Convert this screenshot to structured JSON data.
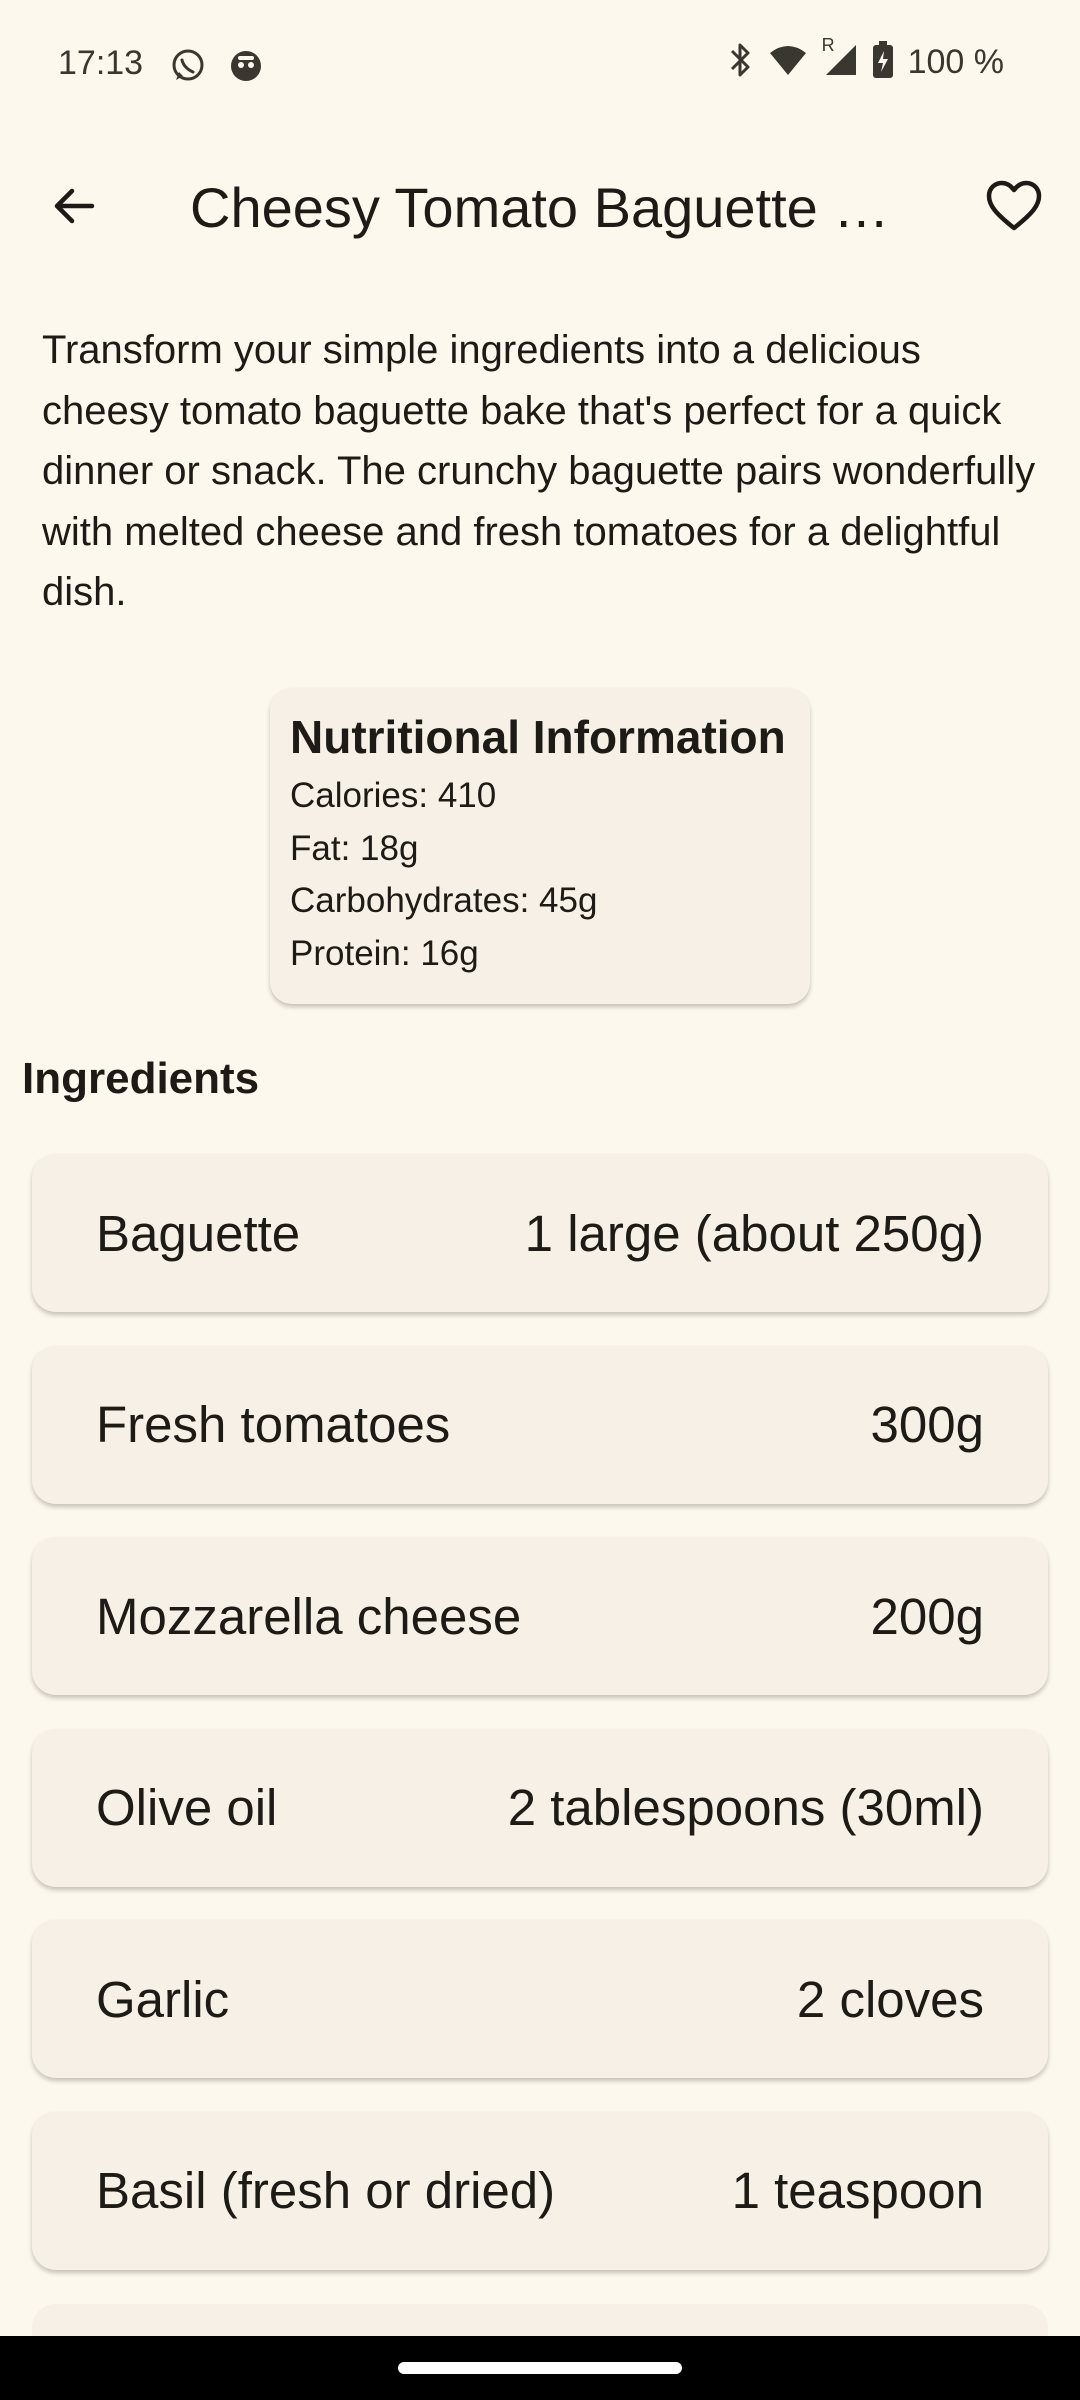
{
  "status_bar": {
    "time": "17:13",
    "battery": "100 %",
    "icons": [
      "whatsapp-icon",
      "messenger-app-icon",
      "bluetooth-icon",
      "wifi-icon",
      "cell-signal-icon",
      "battery-charging-icon"
    ],
    "roaming_indicator": "R"
  },
  "app_bar": {
    "title": "Cheesy Tomato Baguette …",
    "back_icon": "arrow-back-icon",
    "favorite_icon": "heart-outline-icon"
  },
  "description": "Transform your simple ingredients into a delicious cheesy tomato baguette bake that's perfect for a quick dinner or snack. The crunchy baguette pairs wonderfully with melted cheese and fresh tomatoes for a delightful dish.",
  "nutrition": {
    "title": "Nutritional Information",
    "lines": [
      "Calories: 410",
      "Fat: 18g",
      "Carbohydrates: 45g",
      "Protein: 16g"
    ]
  },
  "ingredients": {
    "heading": "Ingredients",
    "items": [
      {
        "name": "Baguette",
        "amount": "1 large (about 250g)"
      },
      {
        "name": "Fresh tomatoes",
        "amount": "300g"
      },
      {
        "name": "Mozzarella cheese",
        "amount": "200g"
      },
      {
        "name": "Olive oil",
        "amount": "2 tablespoons (30ml)"
      },
      {
        "name": "Garlic",
        "amount": "2 cloves"
      },
      {
        "name": "Basil (fresh or dried)",
        "amount": "1 teaspoon"
      }
    ]
  },
  "colors": {
    "background": "#fdf8ee",
    "card": "#f6f0e6",
    "text": "#1e1b16"
  }
}
